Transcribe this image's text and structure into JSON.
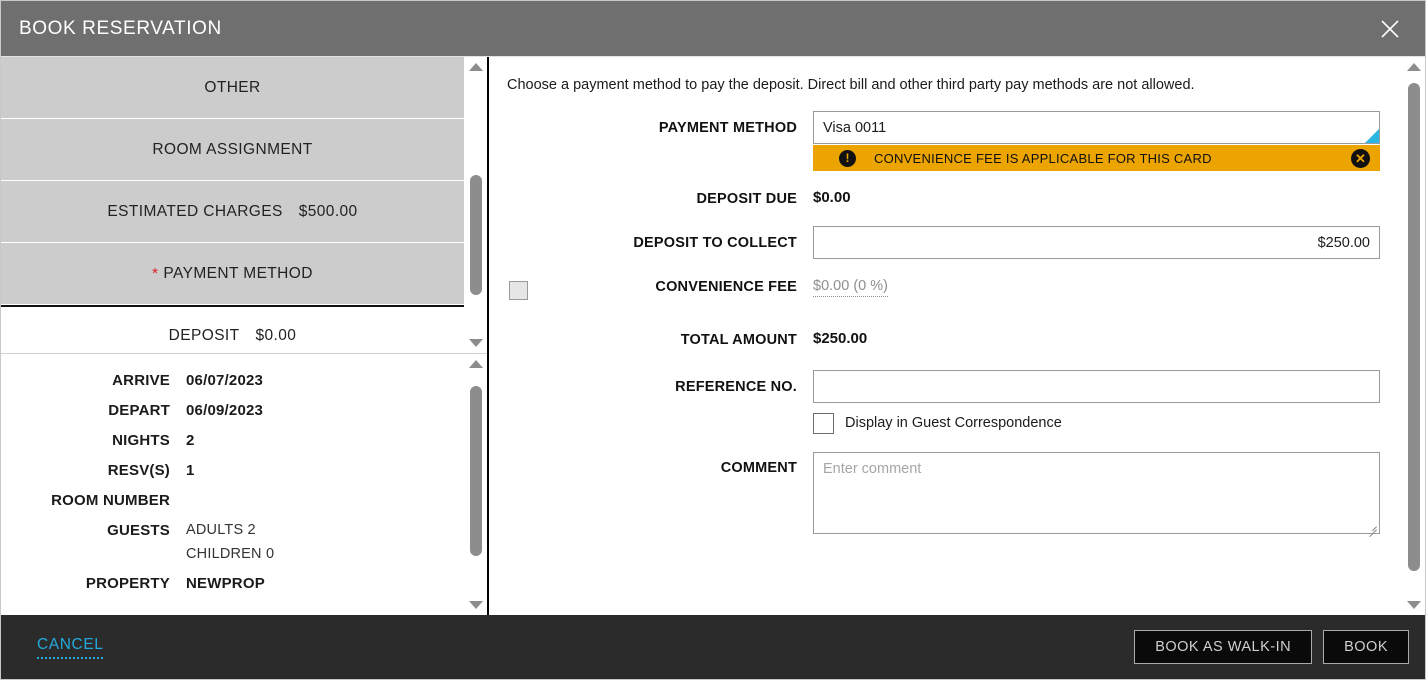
{
  "titlebar": {
    "title": "BOOK RESERVATION",
    "close_icon": "close-icon"
  },
  "sidebar": {
    "accordion": [
      {
        "label": "OTHER",
        "amount": "",
        "required": false,
        "selected": false
      },
      {
        "label": "ROOM ASSIGNMENT",
        "amount": "",
        "required": false,
        "selected": false
      },
      {
        "label": "ESTIMATED CHARGES",
        "amount": "$500.00",
        "required": false,
        "selected": false
      },
      {
        "label": "PAYMENT METHOD",
        "amount": "",
        "required": true,
        "selected": false
      },
      {
        "label": "DEPOSIT",
        "amount": "$0.00",
        "required": false,
        "selected": true
      }
    ],
    "details": [
      {
        "label": "ARRIVE",
        "value": "06/07/2023",
        "value2": ""
      },
      {
        "label": "DEPART",
        "value": "06/09/2023",
        "value2": ""
      },
      {
        "label": "NIGHTS",
        "value": "2",
        "value2": ""
      },
      {
        "label": "RESV(S)",
        "value": "1",
        "value2": ""
      },
      {
        "label": "ROOM NUMBER",
        "value": "",
        "value2": ""
      },
      {
        "label": "GUESTS",
        "value": "ADULTS 2",
        "value2": "CHILDREN 0"
      },
      {
        "label": "PROPERTY",
        "value": "NEWPROP",
        "value2": ""
      }
    ]
  },
  "main": {
    "intro": "Choose a payment method to pay the deposit. Direct bill and other third party pay methods are not allowed.",
    "payment_method": {
      "label": "PAYMENT METHOD",
      "value": "Visa 0011",
      "warning": {
        "icon": "exclamation-icon",
        "text": "CONVENIENCE FEE IS APPLICABLE FOR THIS CARD",
        "close_icon": "close-circle-icon"
      }
    },
    "deposit_due": {
      "label": "DEPOSIT DUE",
      "value": "$0.00"
    },
    "deposit_to_collect": {
      "label": "DEPOSIT TO COLLECT",
      "value": "$250.00"
    },
    "convenience_fee": {
      "label": "CONVENIENCE FEE",
      "value": "$0.00 (0 %)",
      "checked": false
    },
    "total_amount": {
      "label": "TOTAL AMOUNT",
      "value": "$250.00"
    },
    "reference_no": {
      "label": "REFERENCE NO.",
      "value": "",
      "placeholder": ""
    },
    "display_in_guest_correspondence": {
      "label": "Display in Guest Correspondence",
      "checked": false
    },
    "comment": {
      "label": "COMMENT",
      "value": "",
      "placeholder": "Enter comment"
    }
  },
  "footer": {
    "cancel_label": "CANCEL",
    "book_walkin_label": "BOOK AS WALK-IN",
    "book_label": "BOOK"
  },
  "colors": {
    "titlebar_bg": "#706F6F",
    "accordion_bg": "#CCCCCC",
    "warning_bg": "#ECA400",
    "accent_cyan": "#29B6E0",
    "footer_bg": "#2B2B2B",
    "cancel_link": "#23A9DD",
    "required_star": "#E01B1B"
  }
}
